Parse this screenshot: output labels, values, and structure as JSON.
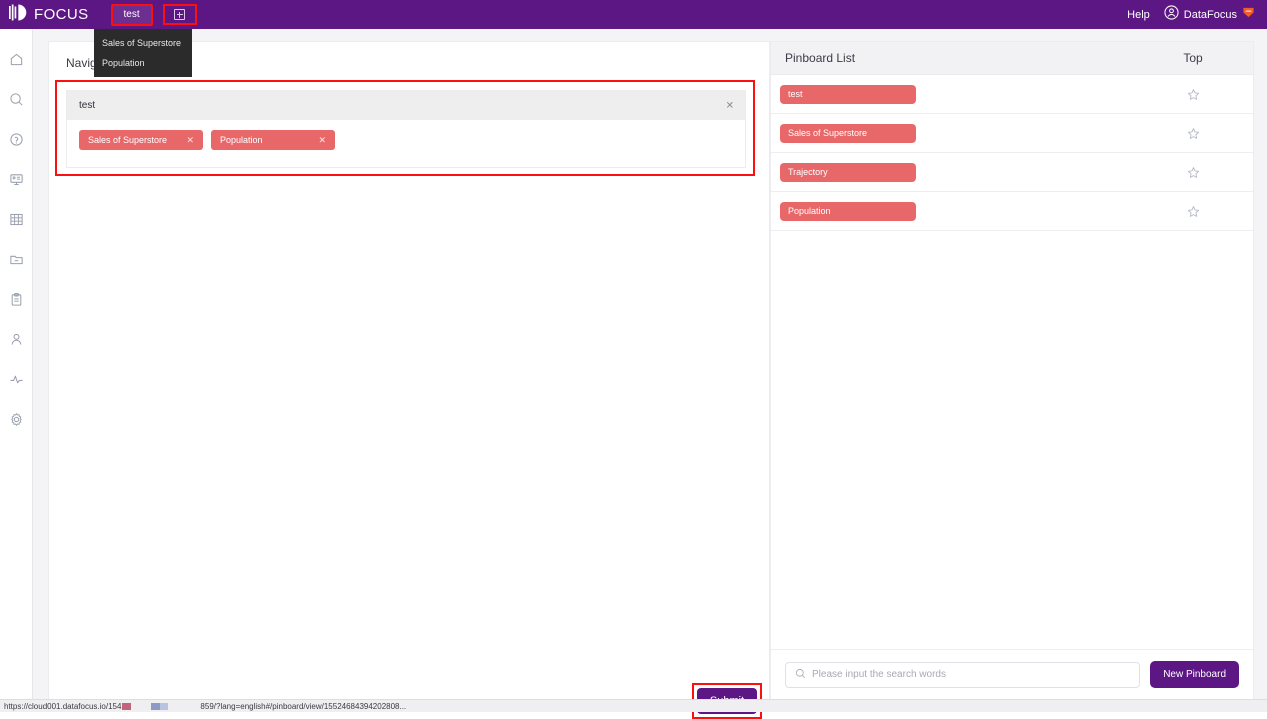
{
  "topbar": {
    "brand": "FOCUS",
    "brand_icon": "focus-logo-icon",
    "tabs": [
      {
        "label": "test",
        "active": true,
        "highlighted": true
      }
    ],
    "add_tab_icon": "box-plus-icon",
    "help_label": "Help",
    "user_icon": "user-circle-icon",
    "user_name": "DataFocus",
    "badge_icon": "shield-badge-icon",
    "accent_purple": "#5d1785",
    "highlight_red": "#fb0f0f"
  },
  "dropdown": {
    "items": [
      {
        "label": "Sales of Superstore"
      },
      {
        "label": "Population"
      }
    ]
  },
  "sidebar": {
    "items": [
      {
        "name": "home",
        "icon": "home-icon"
      },
      {
        "name": "search",
        "icon": "search-icon"
      },
      {
        "name": "question",
        "icon": "question-circle-icon"
      },
      {
        "name": "board",
        "icon": "presentation-board-icon"
      },
      {
        "name": "table",
        "icon": "table-grid-icon"
      },
      {
        "name": "folder",
        "icon": "folder-minus-icon"
      },
      {
        "name": "clipboard",
        "icon": "clipboard-icon"
      },
      {
        "name": "user",
        "icon": "user-icon"
      },
      {
        "name": "activity",
        "icon": "activity-pulse-icon"
      },
      {
        "name": "settings",
        "icon": "gear-icon"
      }
    ]
  },
  "main": {
    "panel_title": "Navigat",
    "search": {
      "value": "test",
      "clear_icon": "close-x-icon",
      "chips": [
        {
          "label": "Sales of Superstore",
          "close_icon": "close-x-icon"
        },
        {
          "label": "Population",
          "close_icon": "close-x-icon"
        }
      ]
    },
    "submit_label": "Submit"
  },
  "pinboard": {
    "header": {
      "title": "Pinboard List",
      "top_column": "Top"
    },
    "rows": [
      {
        "label": "test",
        "star_icon": "star-outline-icon",
        "starred": false
      },
      {
        "label": "Sales of Superstore",
        "star_icon": "star-outline-icon",
        "starred": false
      },
      {
        "label": "Trajectory",
        "star_icon": "star-outline-icon",
        "starred": false
      },
      {
        "label": "Population",
        "star_icon": "star-outline-icon",
        "starred": false
      }
    ],
    "chip_color": "#e8686a",
    "footer": {
      "search_placeholder": "Please input the search words",
      "search_value": "",
      "search_icon": "search-icon",
      "new_pinboard_label": "New Pinboard"
    }
  },
  "statusbar": {
    "url_left": "https://cloud001.datafocus.io/154",
    "url_right": "859/?lang=english#/pinboard/view/15524684394202808..."
  }
}
